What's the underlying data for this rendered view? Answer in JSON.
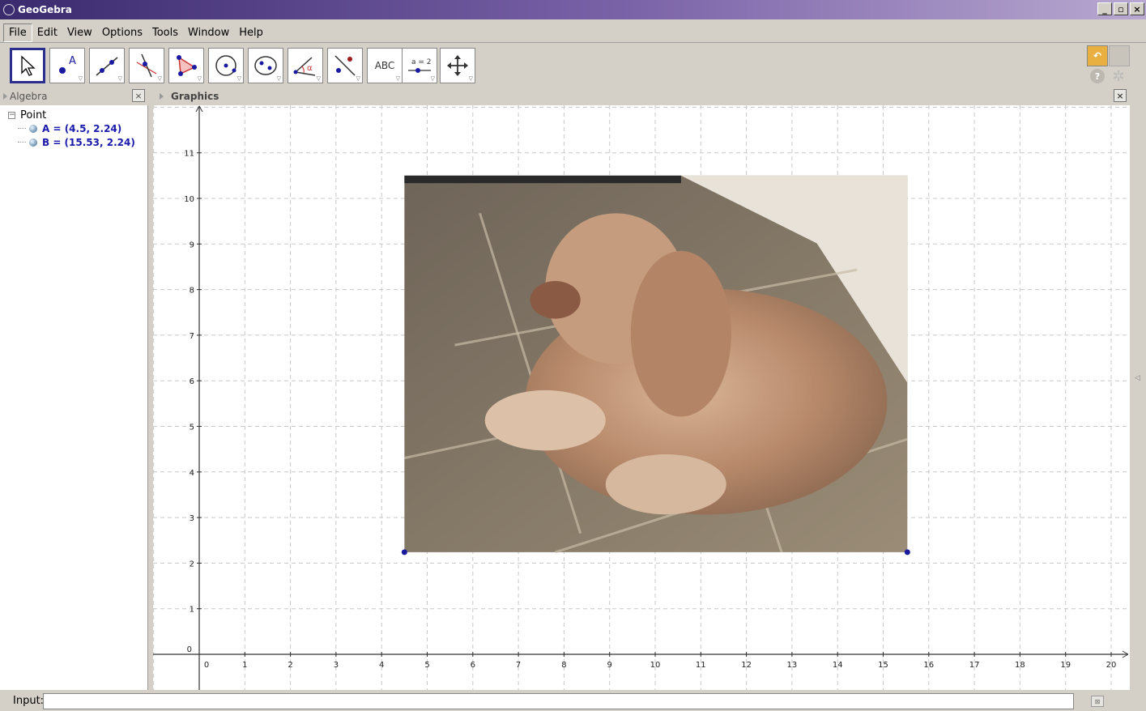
{
  "window": {
    "title": "GeoGebra",
    "minimize": "_",
    "maximize": "▫",
    "close": "×"
  },
  "menubar": [
    "File",
    "Edit",
    "View",
    "Options",
    "Tools",
    "Window",
    "Help"
  ],
  "toolbar": {
    "tools": [
      {
        "name": "move-tool-icon"
      },
      {
        "name": "point-tool-icon",
        "label": "A"
      },
      {
        "name": "line-tool-icon"
      },
      {
        "name": "perpendicular-tool-icon"
      },
      {
        "name": "polygon-tool-icon"
      },
      {
        "name": "circle-tool-icon"
      },
      {
        "name": "ellipse-tool-icon"
      },
      {
        "name": "angle-tool-icon",
        "label": "α"
      },
      {
        "name": "reflect-tool-icon"
      },
      {
        "name": "text-tool-icon",
        "label": "ABC"
      },
      {
        "name": "slider-tool-icon",
        "label": "a = 2"
      },
      {
        "name": "move-view-tool-icon"
      }
    ],
    "help_label": "?",
    "accent": "#2a2e8c"
  },
  "algebra": {
    "title": "Algebra",
    "close": "×",
    "group": "Point",
    "items": [
      {
        "label": "A = (4.5, 2.24)"
      },
      {
        "label": "B = (15.53, 2.24)"
      }
    ]
  },
  "graphics": {
    "title": "Graphics",
    "close": "×",
    "x_ticks": [
      "0",
      "1",
      "2",
      "3",
      "4",
      "5",
      "6",
      "7",
      "8",
      "9",
      "10",
      "11",
      "12",
      "13",
      "14",
      "15",
      "16",
      "17",
      "18",
      "19",
      "20"
    ],
    "y_ticks": [
      "0",
      "1",
      "2",
      "3",
      "4",
      "5",
      "6",
      "7",
      "8",
      "9",
      "10",
      "11"
    ],
    "points": [
      {
        "name": "A",
        "x": 4.5,
        "y": 2.24
      },
      {
        "name": "B",
        "x": 15.53,
        "y": 2.24
      }
    ],
    "image": {
      "description": "photo",
      "x_min": 4.5,
      "x_max": 15.53,
      "y_min": 2.24,
      "y_max": 10.5
    },
    "point_color": "#1a1a9e"
  },
  "input": {
    "label": "Input:",
    "value": ""
  }
}
